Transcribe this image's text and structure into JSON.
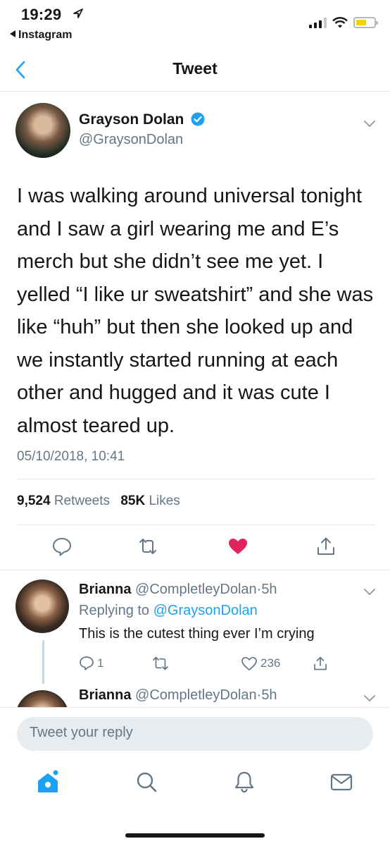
{
  "status_bar": {
    "time": "19:29",
    "back_app": "Instagram",
    "battery_color": "#f2d400"
  },
  "nav": {
    "title": "Tweet",
    "back_icon": "chevron-left-icon"
  },
  "tweet": {
    "author_name": "Grayson Dolan",
    "author_handle": "@GraysonDolan",
    "verified": true,
    "text": "I was walking around universal tonight and I saw a girl wearing me and E’s merch but she didn’t see me yet. I yelled “I like ur sweatshirt” and she was like “huh” but then she looked up and we instantly started running at each other and hugged and it was cute I almost teared up.",
    "timestamp": "05/10/2018, 10:41",
    "retweets_count": "9,524",
    "retweets_label": "Retweets",
    "likes_count": "85K",
    "likes_label": "Likes",
    "liked": true,
    "like_color": "#e0245e"
  },
  "replies": [
    {
      "name": "Brianna",
      "handle": "@CompletleyDolan",
      "dot": "·",
      "time": "5h",
      "replying_prefix": "Replying to",
      "replying_to": "@GraysonDolan",
      "text": "This is the cutest thing ever I’m crying",
      "reply_count": "1",
      "like_count": "236"
    },
    {
      "name": "Brianna",
      "handle": "@CompletleyDolan",
      "dot": "·",
      "time": "5h"
    }
  ],
  "composer": {
    "placeholder": "Tweet your reply"
  },
  "tabbar": {
    "items": [
      "home-icon",
      "search-icon",
      "bell-icon",
      "mail-icon"
    ],
    "active_color": "#1da1f2"
  }
}
